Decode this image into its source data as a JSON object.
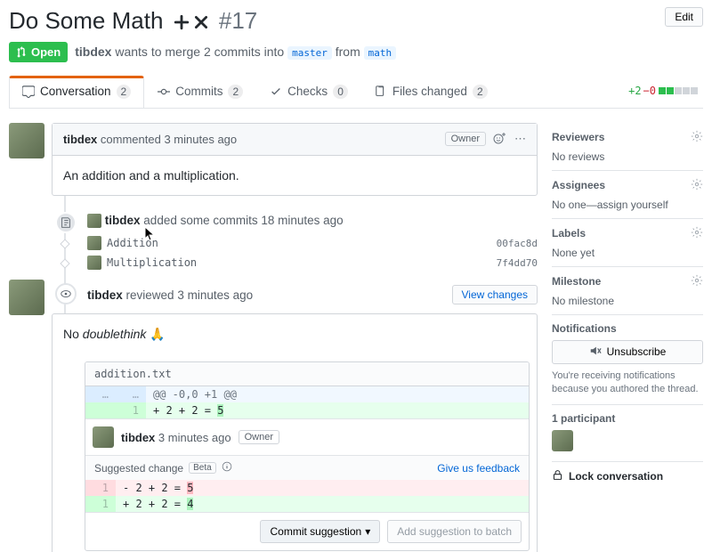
{
  "header": {
    "title": "Do Some Math",
    "number": "#17",
    "edit": "Edit",
    "state": "Open",
    "actor": "tibdex",
    "merge_text_1": "wants to merge 2 commits into",
    "branch_base": "master",
    "merge_text_2": "from",
    "branch_head": "math"
  },
  "tabs": {
    "conversation": {
      "label": "Conversation",
      "count": "2"
    },
    "commits": {
      "label": "Commits",
      "count": "2"
    },
    "checks": {
      "label": "Checks",
      "count": "0"
    },
    "files": {
      "label": "Files changed",
      "count": "2"
    }
  },
  "diffstat": {
    "add": "+2",
    "del": "−0"
  },
  "op_comment": {
    "author": "tibdex",
    "action": "commented",
    "time": "3 minutes ago",
    "role": "Owner",
    "body": "An addition and a multiplication."
  },
  "commits_event": {
    "author": "tibdex",
    "action": "added some commits",
    "time": "18 minutes ago",
    "items": [
      {
        "name": "Addition",
        "sha": "00fac8d"
      },
      {
        "name": "Multiplication",
        "sha": "7f4dd70"
      }
    ]
  },
  "review_event": {
    "author": "tibdex",
    "action": "reviewed",
    "time": "3 minutes ago",
    "view_changes": "View changes",
    "body_pre": "No ",
    "body_em": "doublethink",
    "body_post": " 🙏"
  },
  "file": {
    "name": "addition.txt",
    "hunk": "@@ -0,0 +1 @@",
    "add_ln": "1",
    "add_code_pre": "+ 2 + 2 = ",
    "add_code_hl": "5"
  },
  "inline": {
    "author": "tibdex",
    "time": "3 minutes ago",
    "role": "Owner",
    "suggest_label": "Suggested change",
    "beta": "Beta",
    "feedback": "Give us feedback",
    "del_ln": "1",
    "del_code_pre": "- 2 + 2 = ",
    "del_code_hl": "5",
    "add_ln": "1",
    "add_code_pre": "+ 2 + 2 = ",
    "add_code_hl": "4",
    "commit_suggestion": "Commit suggestion",
    "add_to_batch": "Add suggestion to batch"
  },
  "side": {
    "reviewers": {
      "title": "Reviewers",
      "body": "No reviews"
    },
    "assignees": {
      "title": "Assignees",
      "body": "No one—assign yourself"
    },
    "labels": {
      "title": "Labels",
      "body": "None yet"
    },
    "milestone": {
      "title": "Milestone",
      "body": "No milestone"
    },
    "notifications": {
      "title": "Notifications",
      "unsubscribe": "Unsubscribe",
      "note": "You're receiving notifications because you authored the thread."
    },
    "participants": {
      "title": "1 participant"
    },
    "lock": "Lock conversation"
  }
}
